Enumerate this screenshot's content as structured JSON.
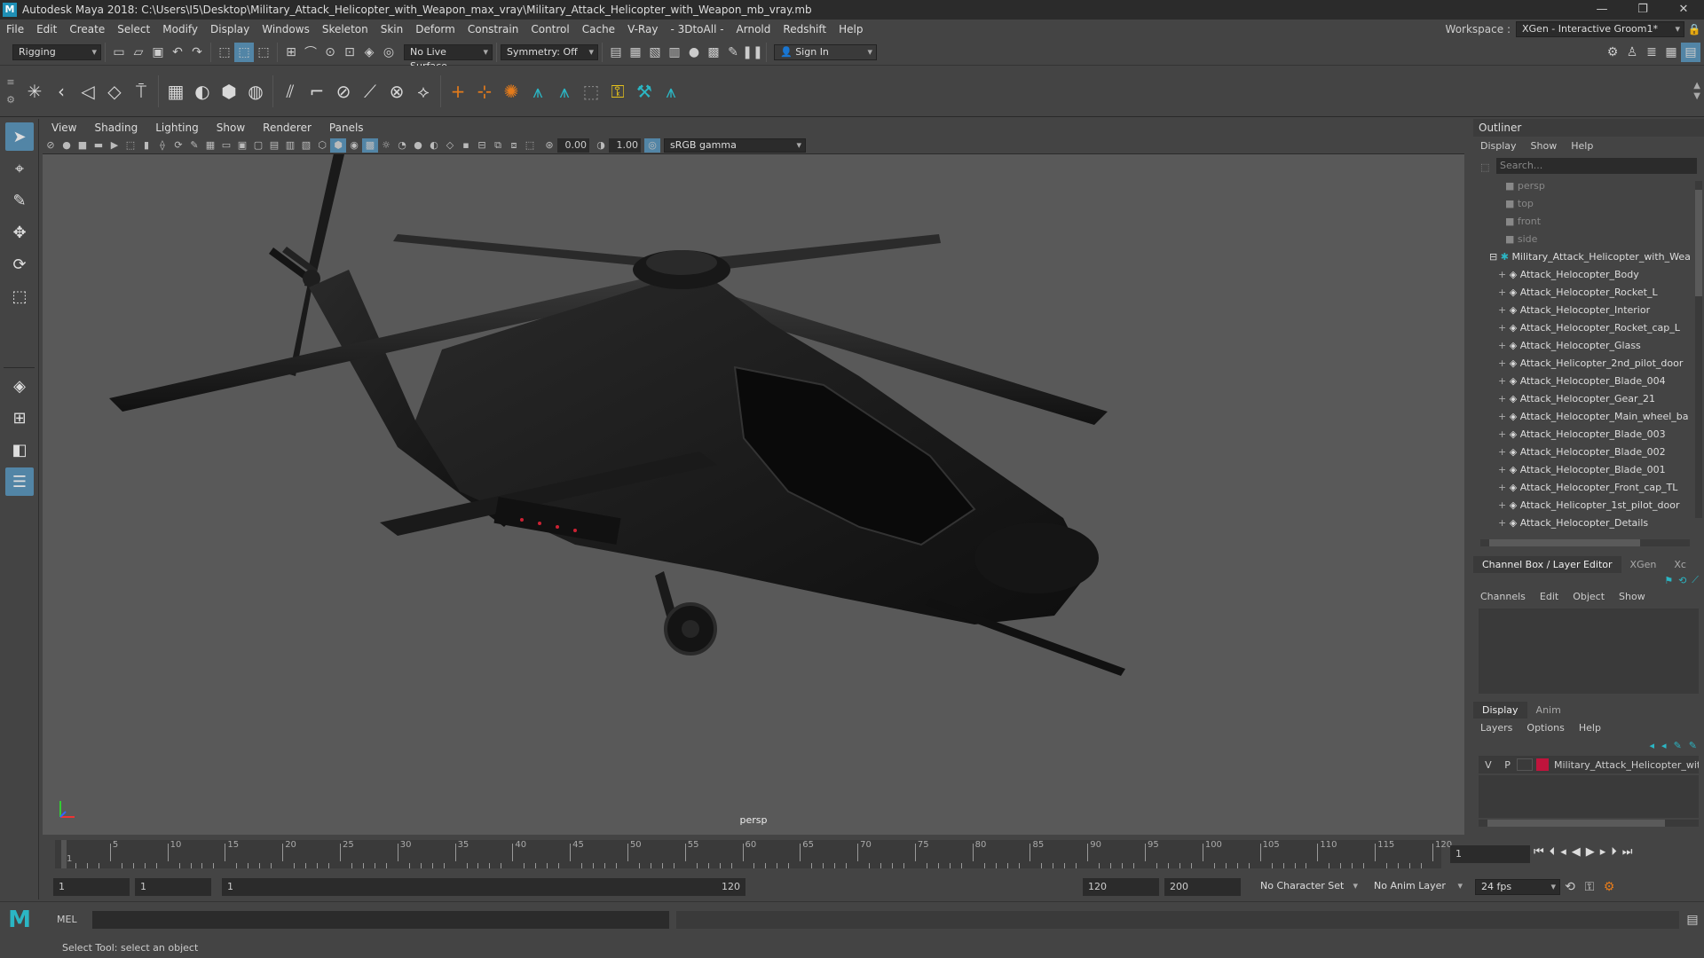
{
  "titlebar": {
    "title": "Autodesk Maya 2018: C:\\Users\\I5\\Desktop\\Military_Attack_Helicopter_with_Weapon_max_vray\\Military_Attack_Helicopter_with_Weapon_mb_vray.mb",
    "minimize": "—",
    "maximize": "❐",
    "close": "✕"
  },
  "menubar": {
    "items": [
      "File",
      "Edit",
      "Create",
      "Select",
      "Modify",
      "Display",
      "Windows",
      "Skeleton",
      "Skin",
      "Deform",
      "Constrain",
      "Control",
      "Cache",
      "V-Ray",
      "- 3DtoAll -",
      "Arnold",
      "Redshift",
      "Help"
    ],
    "workspace_label": "Workspace :",
    "workspace_value": "XGen - Interactive Groom1*"
  },
  "statusline": {
    "menuset": "Rigging",
    "live_surface": "No Live Surface",
    "symmetry": "Symmetry: Off",
    "sign_in": "Sign In"
  },
  "viewport": {
    "menu": [
      "View",
      "Shading",
      "Lighting",
      "Show",
      "Renderer",
      "Panels"
    ],
    "exposure": "0.00",
    "gamma": "1.00",
    "colorspace": "sRGB gamma",
    "camera_label": "persp"
  },
  "outliner": {
    "title": "Outliner",
    "menu": [
      "Display",
      "Show",
      "Help"
    ],
    "search_placeholder": "Search...",
    "cameras": [
      "persp",
      "top",
      "front",
      "side"
    ],
    "group": "Military_Attack_Helicopter_with_Wea",
    "children": [
      "Attack_Helocopter_Body",
      "Attack_Helocopter_Rocket_L",
      "Attack_Helocopter_Interior",
      "Attack_Helocopter_Rocket_cap_L",
      "Attack_Helocopter_Glass",
      "Attack_Helicopter_2nd_pilot_door",
      "Attack_Helocopter_Blade_004",
      "Attack_Helocopter_Gear_21",
      "Attack_Helocopter_Main_wheel_ba",
      "Attack_Helocopter_Blade_003",
      "Attack_Helocopter_Blade_002",
      "Attack_Helocopter_Blade_001",
      "Attack_Helocopter_Front_cap_TL",
      "Attack_Helicopter_1st_pilot_door",
      "Attack_Helocopter_Details"
    ]
  },
  "channelbox": {
    "tabs": [
      "Channel Box / Layer Editor",
      "XGen",
      "Xc"
    ],
    "menu": [
      "Channels",
      "Edit",
      "Object",
      "Show"
    ]
  },
  "layers": {
    "tabs": [
      "Display",
      "Anim"
    ],
    "menu": [
      "Layers",
      "Options",
      "Help"
    ],
    "layer_v": "V",
    "layer_p": "P",
    "layer_color": "#c0143c",
    "layer_name": "Military_Attack_Helicopter_wit"
  },
  "timeline": {
    "tick_labels": [
      "1",
      "5",
      "10",
      "15",
      "20",
      "25",
      "30",
      "35",
      "40",
      "45",
      "50",
      "55",
      "60",
      "65",
      "70",
      "75",
      "80",
      "85",
      "90",
      "95",
      "100",
      "105",
      "110",
      "115",
      "120"
    ],
    "current_frame": "1"
  },
  "range": {
    "start": "1",
    "playback_start": "1",
    "slider_start": "1",
    "slider_end": "120",
    "playback_end": "120",
    "end": "200",
    "character_set": "No Character Set",
    "anim_layer": "No Anim Layer",
    "fps": "24 fps"
  },
  "cmdline": {
    "label": "MEL"
  },
  "helpline": {
    "text": "Select Tool: select an object"
  }
}
